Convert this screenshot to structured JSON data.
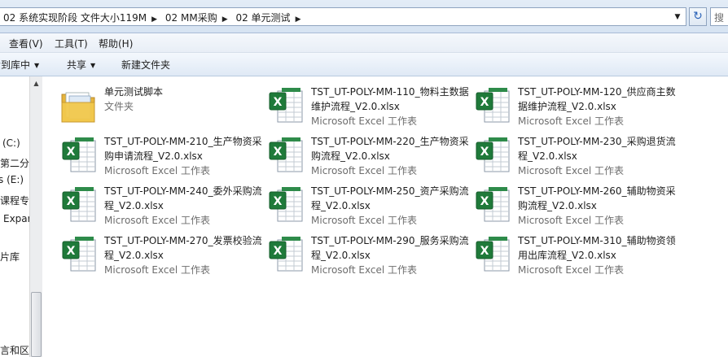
{
  "address": {
    "crumbs": [
      "02 系统实现阶段 文件大小119M",
      "02 MM采购",
      "02 单元测试"
    ],
    "separator": "▶",
    "dropdown_glyph": "▼",
    "refresh_glyph": "↻",
    "search_placeholder": "搜"
  },
  "menu": {
    "items": [
      "查看(V)",
      "工具(T)",
      "帮助(H)"
    ]
  },
  "commands": {
    "library_label": "包含到库中",
    "share_label": "共享",
    "new_folder_label": "新建文件夹",
    "caret": "▼"
  },
  "nav": {
    "items": [
      "(C:)",
      "第二分",
      "s (E:)",
      "课程专",
      "Expar",
      "片库",
      "言和区"
    ]
  },
  "files": [
    {
      "name": "单元测试脚本",
      "type": "文件夹",
      "icon": "folder-icon"
    },
    {
      "name": "TST_UT-POLY-MM-110_物料主数据维护流程_V2.0.xlsx",
      "type": "Microsoft Excel 工作表",
      "icon": "excel-icon"
    },
    {
      "name": "TST_UT-POLY-MM-120_供应商主数据维护流程_V2.0.xlsx",
      "type": "Microsoft Excel 工作表",
      "icon": "excel-icon"
    },
    {
      "name": "TST_UT-POLY-MM-210_生产物资采购申请流程_V2.0.xlsx",
      "type": "Microsoft Excel 工作表",
      "icon": "excel-icon"
    },
    {
      "name": "TST_UT-POLY-MM-220_生产物资采购流程_V2.0.xlsx",
      "type": "Microsoft Excel 工作表",
      "icon": "excel-icon"
    },
    {
      "name": "TST_UT-POLY-MM-230_采购退货流程_V2.0.xlsx",
      "type": "Microsoft Excel 工作表",
      "icon": "excel-icon"
    },
    {
      "name": "TST_UT-POLY-MM-240_委外采购流程_V2.0.xlsx",
      "type": "Microsoft Excel 工作表",
      "icon": "excel-icon"
    },
    {
      "name": "TST_UT-POLY-MM-250_资产采购流程_V2.0.xlsx",
      "type": "Microsoft Excel 工作表",
      "icon": "excel-icon"
    },
    {
      "name": "TST_UT-POLY-MM-260_辅助物资采购流程_V2.0.xlsx",
      "type": "Microsoft Excel 工作表",
      "icon": "excel-icon"
    },
    {
      "name": "TST_UT-POLY-MM-270_发票校验流程_V2.0.xlsx",
      "type": "Microsoft Excel 工作表",
      "icon": "excel-icon"
    },
    {
      "name": "TST_UT-POLY-MM-290_服务采购流程_V2.0.xlsx",
      "type": "Microsoft Excel 工作表",
      "icon": "excel-icon"
    },
    {
      "name": "TST_UT-POLY-MM-310_辅助物资领用出库流程_V2.0.xlsx",
      "type": "Microsoft Excel 工作表",
      "icon": "excel-icon"
    }
  ],
  "colors": {
    "excel_green": "#1f7a3a",
    "folder_yellow": "#f2c94c",
    "secondary_text": "#6d6d6d"
  }
}
